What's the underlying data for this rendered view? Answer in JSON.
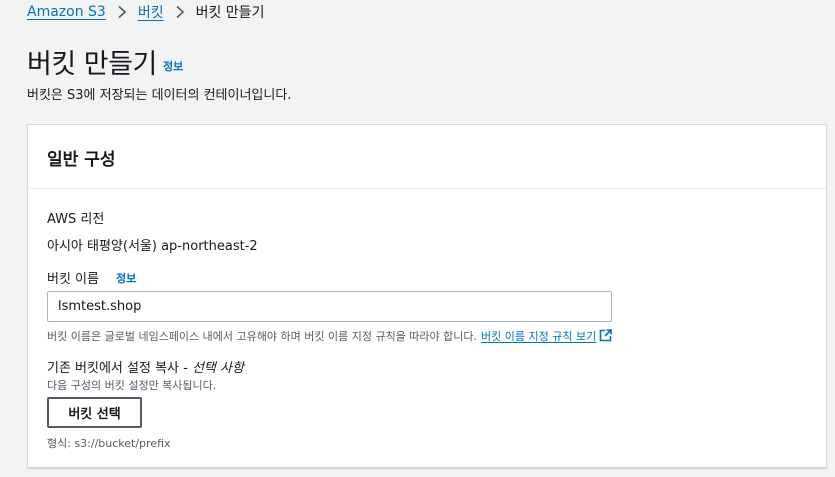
{
  "breadcrumb": {
    "items": [
      "Amazon S3",
      "버킷"
    ],
    "current": "버킷 만들기"
  },
  "page": {
    "title": "버킷 만들기",
    "info_label": "정보",
    "description": "버킷은 S3에 저장되는 데이터의 컨테이너입니다."
  },
  "general_config": {
    "title": "일반 구성",
    "region": {
      "label": "AWS 리전",
      "value": "아시아 태평양(서울) ap-northeast-2"
    },
    "bucket_name": {
      "label": "버킷 이름",
      "info_label": "정보",
      "value": "lsmtest.shop",
      "hint": "버킷 이름은 글로벌 네임스페이스 내에서 고유해야 하며 버킷 이름 지정 규칙을 따라야 합니다.",
      "rules_link": "버킷 이름 지정 규칙 보기"
    },
    "copy_settings": {
      "label": "기존 버킷에서 설정 복사 - ",
      "label_optional": "선택 사항",
      "description": "다음 구성의 버킷 설정만 복사됩니다.",
      "button": "버킷 선택",
      "format": "형식: s3://bucket/prefix"
    }
  },
  "colors": {
    "link": "#0073bb",
    "background": "#f2f3f3",
    "text": "#16191f",
    "muted": "#545b64"
  }
}
